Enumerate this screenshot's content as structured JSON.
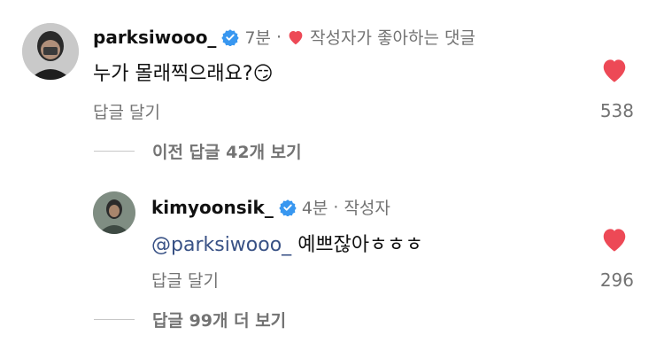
{
  "comment": {
    "username": "parksiwooo_",
    "time": "7분",
    "author_liked": "작성자가 좋아하는 댓글",
    "text": "누가 몰래찍으래요?😏",
    "reply_label": "답글 달기",
    "like_count": "538"
  },
  "prev_replies": "이전 답글 42개 보기",
  "reply": {
    "username": "kimyoonsik_",
    "time": "4분",
    "separator": "·",
    "author_badge": "작성자",
    "mention": "@parksiwooo_",
    "text": "예쁘잖아ㅎㅎㅎ",
    "reply_label": "답글 달기",
    "like_count": "296"
  },
  "more_replies": "답글 99개 더 보기",
  "colors": {
    "heart": "#ed4956",
    "verified": "#3897f0",
    "mention": "#385185",
    "muted": "#737373"
  }
}
